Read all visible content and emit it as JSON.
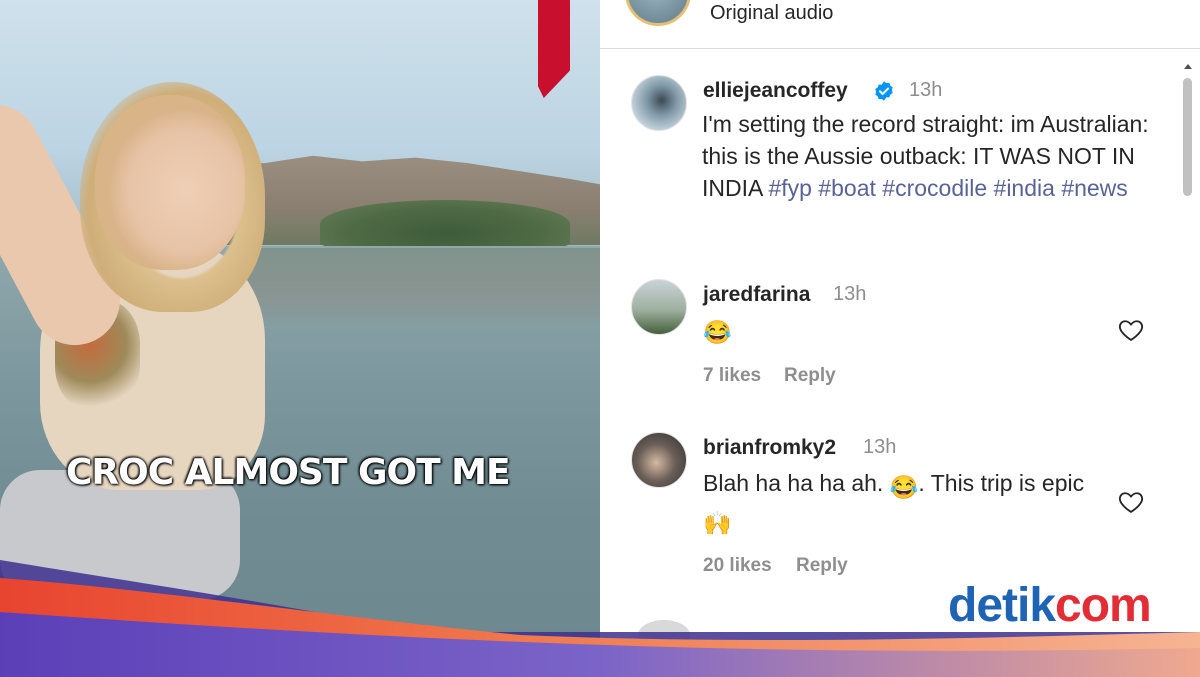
{
  "video": {
    "caption": "CROC ALMOST GOT ME"
  },
  "audio": {
    "label": "Original audio"
  },
  "post": {
    "username": "elliejeancoffey",
    "time": "13h",
    "verified_icon": "verified-badge-icon",
    "text_plain": "I'm setting the record straight: im Australian: this is the Aussie outback: IT WAS NOT IN INDIA",
    "hashtags": [
      "#fyp",
      "#boat",
      "#crocodile",
      "#india",
      "#news"
    ]
  },
  "comments": [
    {
      "username": "jaredfarina",
      "time": "13h",
      "emoji": "😂",
      "likes": "7 likes",
      "reply": "Reply"
    },
    {
      "username": "brianfromky2",
      "time": "13h",
      "text_before": "Blah ha ha ha ah.",
      "emoji1": "😂",
      "text_after": ". This trip is epic",
      "emoji2": "🙌",
      "likes": "20 likes",
      "reply": "Reply"
    }
  ],
  "logo": {
    "part1": "detik",
    "part2": "com"
  },
  "colors": {
    "hashtag": "#5a6396",
    "verified": "#0095f6",
    "logo_blue": "#1f63b5",
    "logo_red": "#e22d35",
    "ribbon": "#c8102e"
  }
}
